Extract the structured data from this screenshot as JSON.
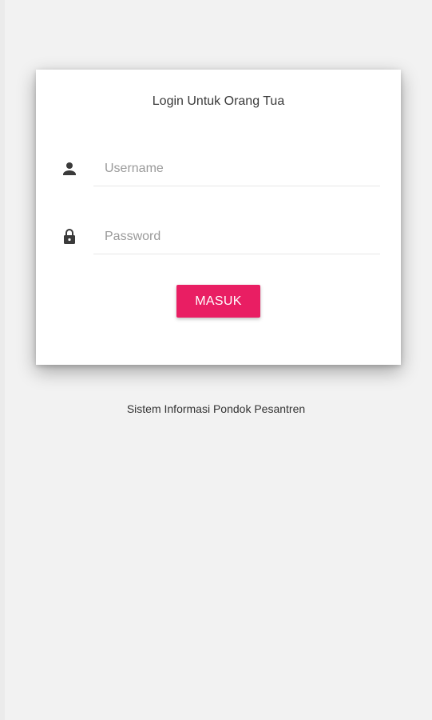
{
  "login_card": {
    "title": "Login Untuk Orang Tua",
    "username": {
      "placeholder": "Username",
      "value": "",
      "icon": "person-icon"
    },
    "password": {
      "placeholder": "Password",
      "value": "",
      "icon": "lock-icon"
    },
    "submit_label": "MASUK"
  },
  "footer": {
    "text": "Sistem Informasi Pondok Pesantren"
  },
  "colors": {
    "accent": "#e91e63",
    "background": "#f2f2f2",
    "card": "#ffffff",
    "icon": "#3a3a3a"
  }
}
